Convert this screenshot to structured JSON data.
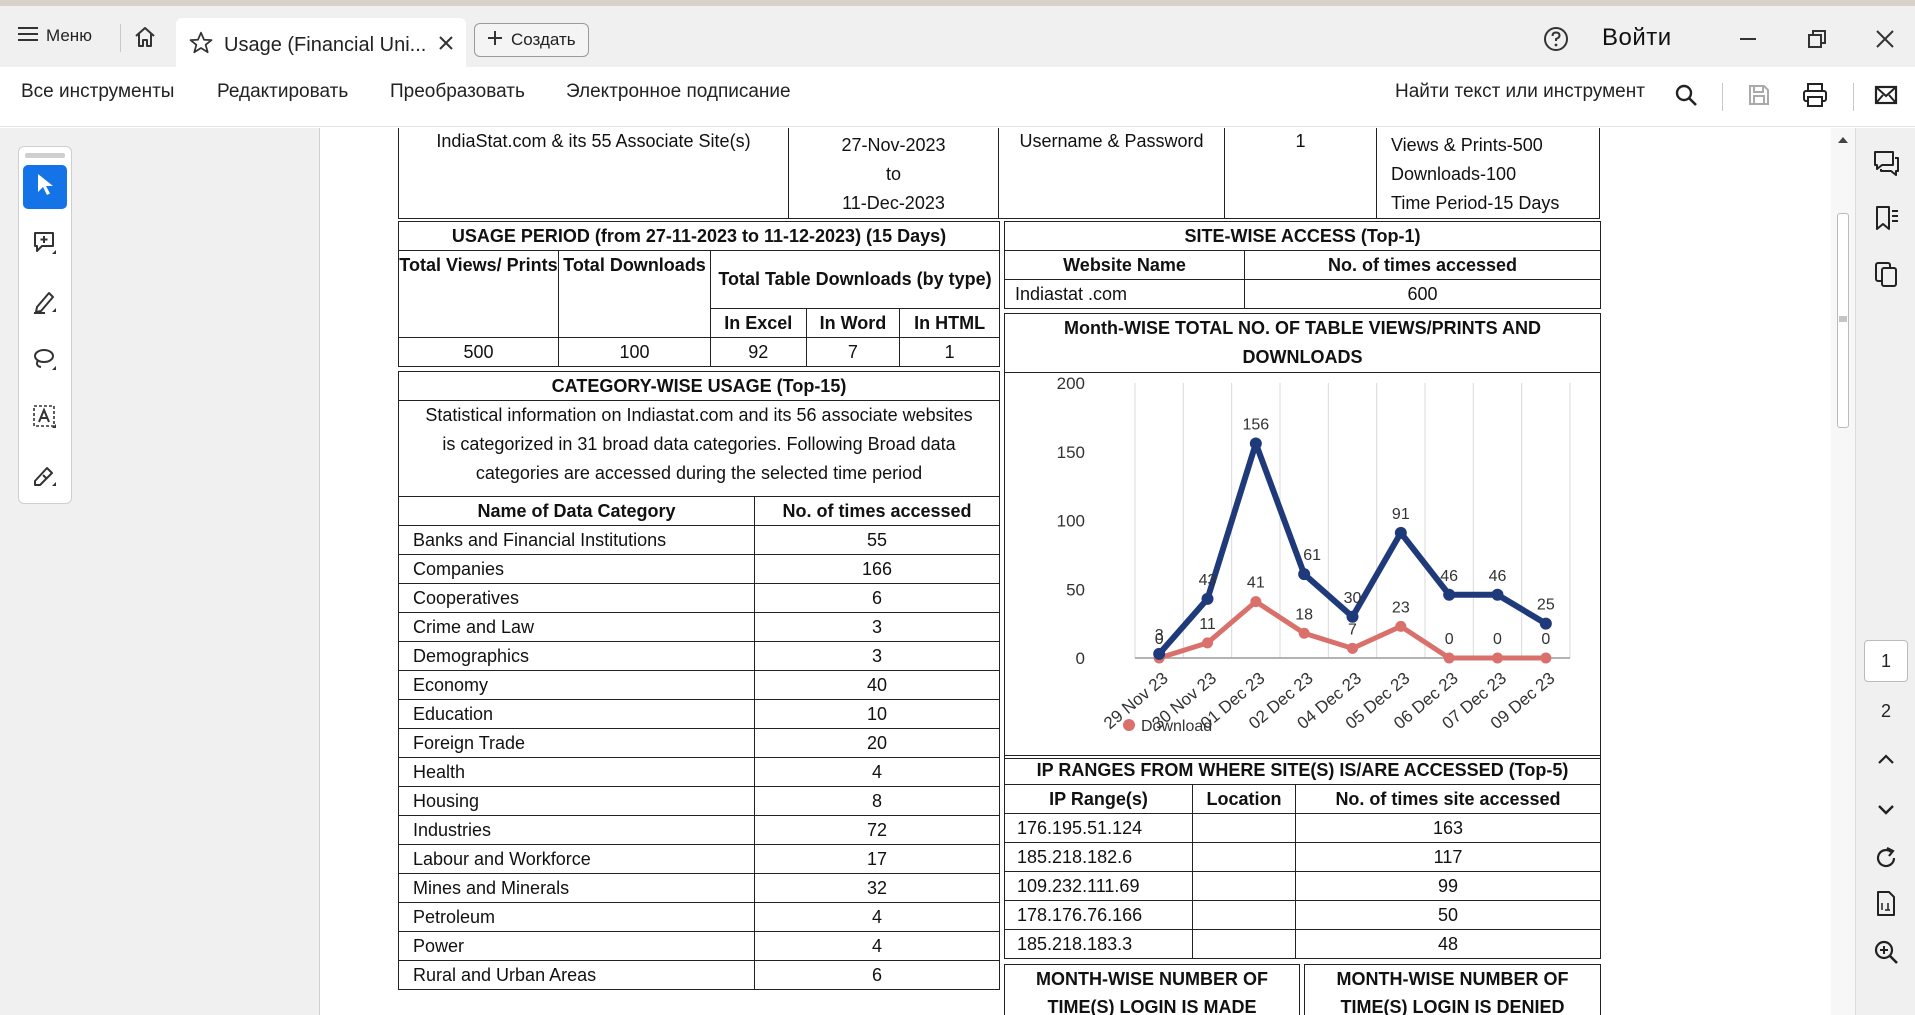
{
  "app": {
    "menu_label": "Меню",
    "tab_title": "Usage (Financial Uni...",
    "create_label": "Создать",
    "signin_label": "Войти"
  },
  "toolbar": {
    "items": [
      "Все инструменты",
      "Редактировать",
      "Преобразовать",
      "Электронное подписание"
    ],
    "find_label": "Найти текст или инструмент"
  },
  "pager": {
    "pages": [
      "1",
      "2"
    ],
    "current": "1"
  },
  "doc": {
    "top_row": {
      "site": "IndiaStat.com & its 55 Associate Site(s)",
      "date_from": "27-Nov-2023",
      "date_to_word": "to",
      "date_to": "11-Dec-2023",
      "auth": "Username & Password",
      "users": "1",
      "limits": [
        "Views & Prints-500",
        "Downloads-100",
        "Time Period-15 Days"
      ]
    },
    "usage_period": {
      "title": "USAGE PERIOD (from 27-11-2023 to 11-12-2023) (15 Days)",
      "col_views": "Total Views/ Prints",
      "col_downloads": "Total Downloads",
      "col_table_dl": "Total Table Downloads (by type)",
      "col_excel": "In Excel",
      "col_word": "In Word",
      "col_html": "In HTML",
      "views": "500",
      "downloads": "100",
      "excel": "92",
      "word": "7",
      "html": "1"
    },
    "category": {
      "title": "CATEGORY-WISE USAGE (Top-15)",
      "description": "Statistical information on Indiastat.com and its 56 associate websites is categorized in 31 broad data categories. Following Broad data categories are accessed during the selected time period",
      "col_name": "Name of Data Category",
      "col_count": "No. of times accessed",
      "rows": [
        {
          "name": "Banks and Financial Institutions",
          "count": "55"
        },
        {
          "name": "Companies",
          "count": "166"
        },
        {
          "name": "Cooperatives",
          "count": "6"
        },
        {
          "name": "Crime and Law",
          "count": "3"
        },
        {
          "name": "Demographics",
          "count": "3"
        },
        {
          "name": "Economy",
          "count": "40"
        },
        {
          "name": "Education",
          "count": "10"
        },
        {
          "name": "Foreign Trade",
          "count": "20"
        },
        {
          "name": "Health",
          "count": "4"
        },
        {
          "name": "Housing",
          "count": "8"
        },
        {
          "name": "Industries",
          "count": "72"
        },
        {
          "name": "Labour and Workforce",
          "count": "17"
        },
        {
          "name": "Mines and Minerals",
          "count": "32"
        },
        {
          "name": "Petroleum",
          "count": "4"
        },
        {
          "name": "Power",
          "count": "4"
        },
        {
          "name": "Rural and Urban Areas",
          "count": "6"
        }
      ]
    },
    "sitewise": {
      "title": "SITE-WISE ACCESS (Top-1)",
      "col_site": "Website Name",
      "col_count": "No. of times accessed",
      "site": "Indiastat .com",
      "count": "600"
    },
    "monthwise_title": "Month-WISE TOTAL NO. OF TABLE VIEWS/PRINTS AND DOWNLOADS",
    "ip": {
      "title": "IP RANGES FROM WHERE SITE(S) IS/ARE ACCESSED (Top-5)",
      "col_range": "IP Range(s)",
      "col_location": "Location",
      "col_count": "No. of times site accessed",
      "rows": [
        {
          "range": "176.195.51.124",
          "location": "",
          "count": "163"
        },
        {
          "range": "185.218.182.6",
          "location": "",
          "count": "117"
        },
        {
          "range": "109.232.111.69",
          "location": "",
          "count": "99"
        },
        {
          "range": "178.176.76.166",
          "location": "",
          "count": "50"
        },
        {
          "range": "185.218.183.3",
          "location": "",
          "count": "48"
        }
      ]
    },
    "login_made_title": "MONTH-WISE NUMBER OF TIME(S) LOGIN IS MADE",
    "login_denied_title": "MONTH-WISE NUMBER OF TIME(S) LOGIN IS DENIED"
  },
  "chart_data": {
    "type": "line",
    "categories": [
      "29 Nov 23",
      "30 Nov 23",
      "01 Dec 23",
      "02 Dec 23",
      "04 Dec 23",
      "05 Dec 23",
      "06 Dec 23",
      "07 Dec 23",
      "09 Dec 23"
    ],
    "series": [
      {
        "name": "",
        "color": "#1f3a7a",
        "values": [
          3,
          43,
          156,
          61,
          30,
          91,
          46,
          46,
          25
        ]
      },
      {
        "name": "Download",
        "color": "#d9706b",
        "values": [
          0,
          11,
          41,
          18,
          7,
          23,
          0,
          0,
          0
        ]
      }
    ],
    "ylim": [
      0,
      200
    ],
    "yticks": [
      "0",
      "50",
      "100",
      "150",
      "200"
    ],
    "grid": "vertical",
    "legend": "bottom-left"
  }
}
